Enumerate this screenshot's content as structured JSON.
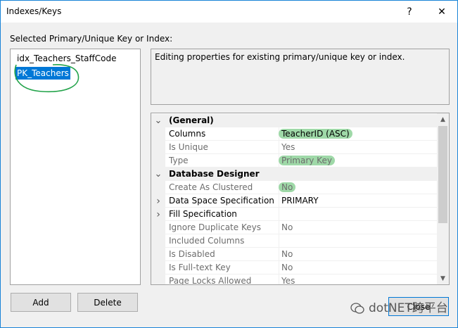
{
  "window": {
    "title": "Indexes/Keys",
    "help_glyph": "?",
    "close_glyph": "✕"
  },
  "selected_label": "Selected Primary/Unique Key or Index:",
  "keys": [
    {
      "label": "idx_Teachers_StaffCode",
      "selected": false
    },
    {
      "label": "PK_Teachers",
      "selected": true
    }
  ],
  "description": "Editing properties for existing primary/unique key or index.",
  "properties": [
    {
      "type": "category",
      "label": "(General)",
      "expanded": true
    },
    {
      "type": "prop",
      "label": "Columns",
      "value": "TeacherID (ASC)",
      "readonly": false,
      "highlight": true
    },
    {
      "type": "prop",
      "label": "Is Unique",
      "value": "Yes",
      "readonly": true,
      "highlight": false
    },
    {
      "type": "prop",
      "label": "Type",
      "value": "Primary Key",
      "readonly": true,
      "highlight": true
    },
    {
      "type": "category",
      "label": "Database Designer",
      "expanded": true
    },
    {
      "type": "prop",
      "label": "Create As Clustered",
      "value": "No",
      "readonly": true,
      "highlight": true
    },
    {
      "type": "prop",
      "label": "Data Space Specification",
      "value": "PRIMARY",
      "readonly": false,
      "highlight": false,
      "expandable": true
    },
    {
      "type": "prop",
      "label": "Fill Specification",
      "value": "",
      "readonly": false,
      "highlight": false,
      "expandable": true
    },
    {
      "type": "prop",
      "label": "Ignore Duplicate Keys",
      "value": "No",
      "readonly": true,
      "highlight": false
    },
    {
      "type": "prop",
      "label": "Included Columns",
      "value": "",
      "readonly": true,
      "highlight": false
    },
    {
      "type": "prop",
      "label": "Is Disabled",
      "value": "No",
      "readonly": true,
      "highlight": false
    },
    {
      "type": "prop",
      "label": "Is Full-text Key",
      "value": "No",
      "readonly": true,
      "highlight": false
    },
    {
      "type": "prop",
      "label": "Page Locks Allowed",
      "value": "Yes",
      "readonly": true,
      "highlight": false
    }
  ],
  "buttons": {
    "add": "Add",
    "delete": "Delete",
    "close": "Close"
  },
  "watermark": "dotNET跨平台",
  "colors": {
    "selection": "#0078d7",
    "highlight": "#9fd9a8",
    "annotation": "#22a34a"
  }
}
